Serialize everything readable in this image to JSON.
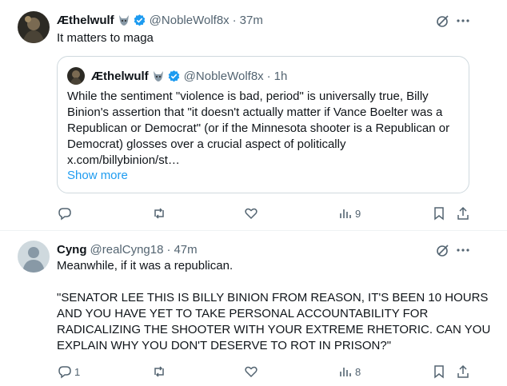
{
  "post1": {
    "name": "Æthelwulf",
    "handle": "@NobleWolf8x",
    "time": "37m",
    "text": "It matters to maga",
    "quote": {
      "name": "Æthelwulf",
      "handle": "@NobleWolf8x",
      "time": "1h",
      "lines": [
        "While the sentiment \"violence is bad, period\" is universally true, Billy",
        "Binion's assertion that \"it doesn't actually matter if Vance Boelter was a",
        "Republican or Democrat\" (or if the Minnesota shooter is a Republican or",
        "Democrat) glosses over a crucial aspect of politically",
        "x.com/billybinion/st…"
      ],
      "show_more": "Show more"
    },
    "actions": {
      "reply_count": "",
      "repost_count": "",
      "like_count": "",
      "views": "9"
    }
  },
  "post2": {
    "name": "Cyng",
    "handle": "@realCyng18",
    "time": "47m",
    "line1": "Meanwhile, if it was a republican.",
    "lines": [
      "\"SENATOR LEE THIS IS BILLY BINION FROM REASON, IT'S BEEN 10 HOURS",
      "AND YOU HAVE YET TO TAKE PERSONAL ACCOUNTABILITY FOR",
      "RADICALIZING THE SHOOTER WITH YOUR EXTREME RHETORIC. CAN YOU",
      "EXPLAIN WHY YOU DON'T DESERVE TO ROT IN PRISON?\""
    ],
    "actions": {
      "reply_count": "1",
      "repost_count": "",
      "like_count": "",
      "views": "8"
    }
  },
  "icons": {
    "verified": "verified-badge-icon",
    "grok": "grok-icon",
    "more": "more-icon",
    "reply": "reply-icon",
    "repost": "repost-icon",
    "like": "like-icon",
    "views": "views-icon",
    "bookmark": "bookmark-icon",
    "share": "share-icon"
  },
  "colors": {
    "accent": "#1d9bf0",
    "secondary_text": "#536471",
    "border": "#cfd9de"
  }
}
